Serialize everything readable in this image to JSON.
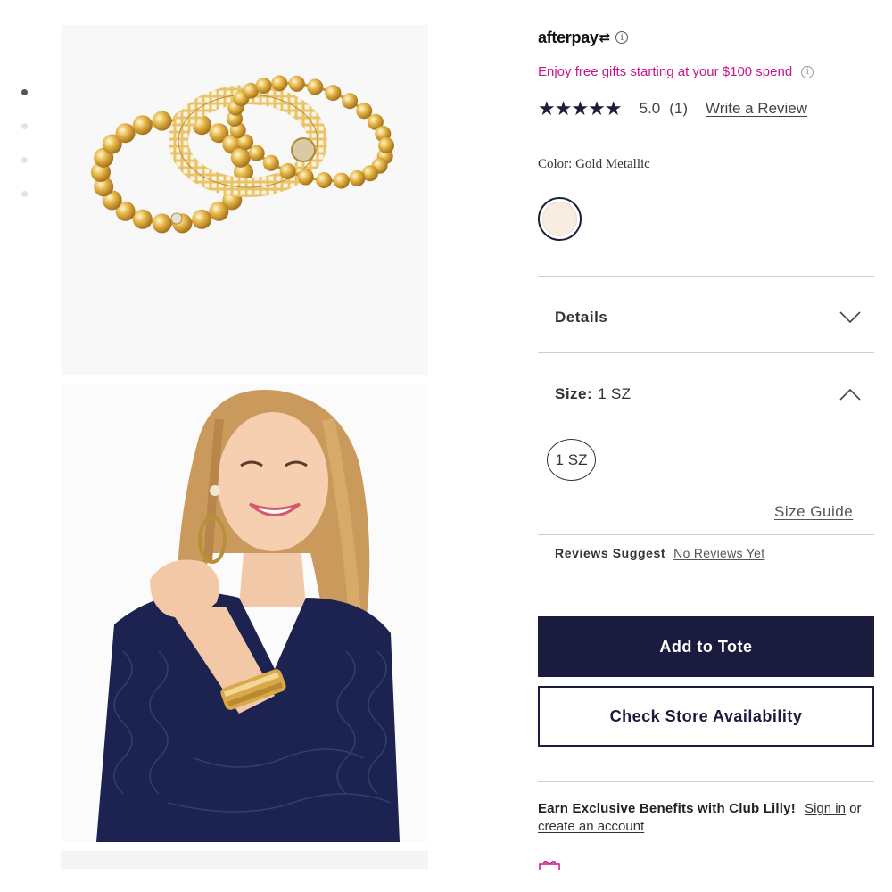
{
  "gallery": {
    "dots": [
      {
        "active": true
      },
      {
        "active": false
      },
      {
        "active": false
      },
      {
        "active": false
      }
    ],
    "images": [
      {
        "name": "bracelet-set-product-image"
      },
      {
        "name": "model-wearing-bracelets-image"
      }
    ]
  },
  "product": {
    "afterpay_logo": "afterpay",
    "afterpay_info": "i",
    "promo_text": "Enjoy free gifts starting at your $100 spend",
    "promo_info": "i",
    "stars": "★★★★★",
    "rating_value": "5.0",
    "rating_count": "(1)",
    "write_review": "Write a Review",
    "color_label": "Color: Gold Metallic",
    "swatch_color": "#f8ede0"
  },
  "accordions": {
    "details_title": "Details",
    "size_title": "Size:",
    "size_value": "1 SZ"
  },
  "size_options": [
    {
      "label": "1 SZ",
      "selected": false
    }
  ],
  "size_guide": "Size Guide",
  "reviews_suggest": {
    "label": "Reviews Suggest",
    "link": "No Reviews Yet"
  },
  "buttons": {
    "add_to_tote": "Add to Tote",
    "check_store": "Check Store Availability"
  },
  "club": {
    "text": "Earn Exclusive Benefits with Club Lilly!",
    "sign_in": "Sign in",
    "or": "or",
    "create_account": "create an account"
  },
  "colors": {
    "navy": "#1b1c3d",
    "promo_pink": "#c5168c"
  }
}
